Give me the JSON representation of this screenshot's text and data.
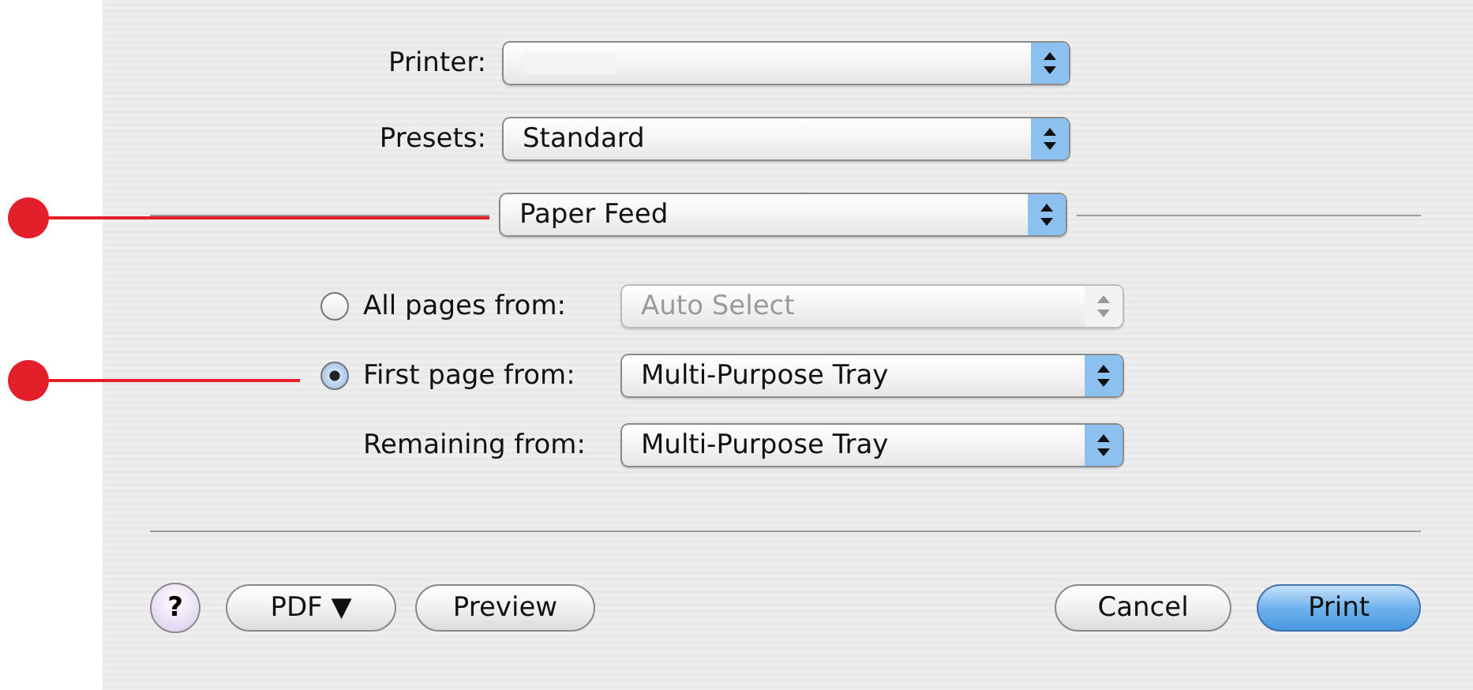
{
  "printer": {
    "label": "Printer:"
  },
  "presets": {
    "label": "Presets:",
    "value": "Standard"
  },
  "panel_menu": {
    "value": "Paper Feed"
  },
  "page_sources": [
    {
      "label": "All pages from:",
      "selected": false,
      "value": "Auto Select",
      "disabled": true
    },
    {
      "label": "First page from:",
      "selected": true,
      "value": "Multi-Purpose Tray",
      "disabled": false
    }
  ],
  "remaining": {
    "label": "Remaining from:",
    "value": "Multi-Purpose Tray"
  },
  "buttons": {
    "help": "?",
    "pdf": "PDF ▼",
    "preview": "Preview",
    "cancel": "Cancel",
    "print": "Print"
  }
}
